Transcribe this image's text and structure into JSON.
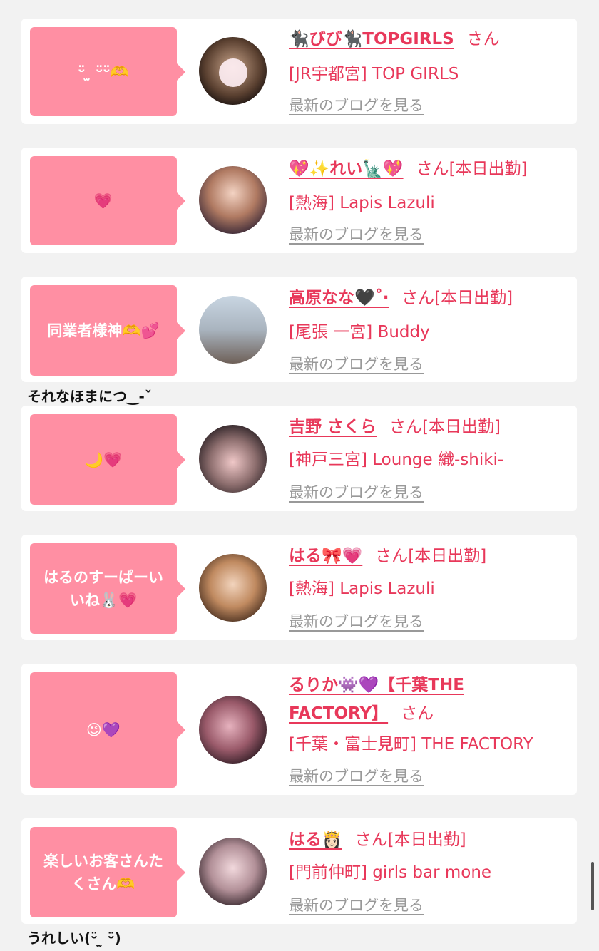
{
  "cards": [
    {
      "bubble": "ᵕ̈ ̫ ᵕ̈ᵕ̈🫶",
      "name": "🐈‍⬛びび🐈‍⬛TOPGIRLS",
      "san": "さん",
      "shop": "[JR宇都宮] TOP GIRLS",
      "blog": "最新のブログを見る"
    },
    {
      "bubble": "💗",
      "name": "💖✨れい🗽💖",
      "san": "さん[本日出勤]",
      "shop": "[熱海] Lapis Lazuli",
      "blog": "最新のブログを見る"
    },
    {
      "bubble": "同業者様神🫶💕",
      "name": "高原なな🖤˚‧",
      "san": "さん[本日出勤]",
      "shop": "[尾張 一宮] Buddy",
      "blog": "最新のブログを見る"
    },
    {
      "bubble": "🌙💗",
      "name": "吉野 さくら",
      "san": "さん[本日出勤]",
      "shop": "[神戸三宮] Lounge 織-shiki-",
      "blog": "最新のブログを見る"
    },
    {
      "bubble": "はるのすーぱーいいね🐰💗",
      "name": "はる🎀💗",
      "san": "さん[本日出勤]",
      "shop": "[熱海] Lapis Lazuli",
      "blog": "最新のブログを見る"
    },
    {
      "bubble": "😉💜",
      "name": "るりか👾💜【千葉THE FACTORY】",
      "san": "さん",
      "shop": "[千葉・富士見町] THE FACTORY",
      "blog": "最新のブログを見る"
    },
    {
      "bubble": "楽しいお客さんたくさん🫶",
      "name": "はる👸🏻",
      "san": "さん[本日出勤]",
      "shop": "[門前仲町] girls bar mone",
      "blog": "最新のブログを見る"
    }
  ],
  "comments": [
    "それなほまにつ‿-ˇ",
    "うれしい(ᵕ̈ ̫ ᵕ̈)"
  ],
  "colors": {
    "accent": "#e8385a",
    "bubble": "#ff8fa3",
    "link_gray": "#999999"
  },
  "icons": [
    "avatar-photo"
  ]
}
